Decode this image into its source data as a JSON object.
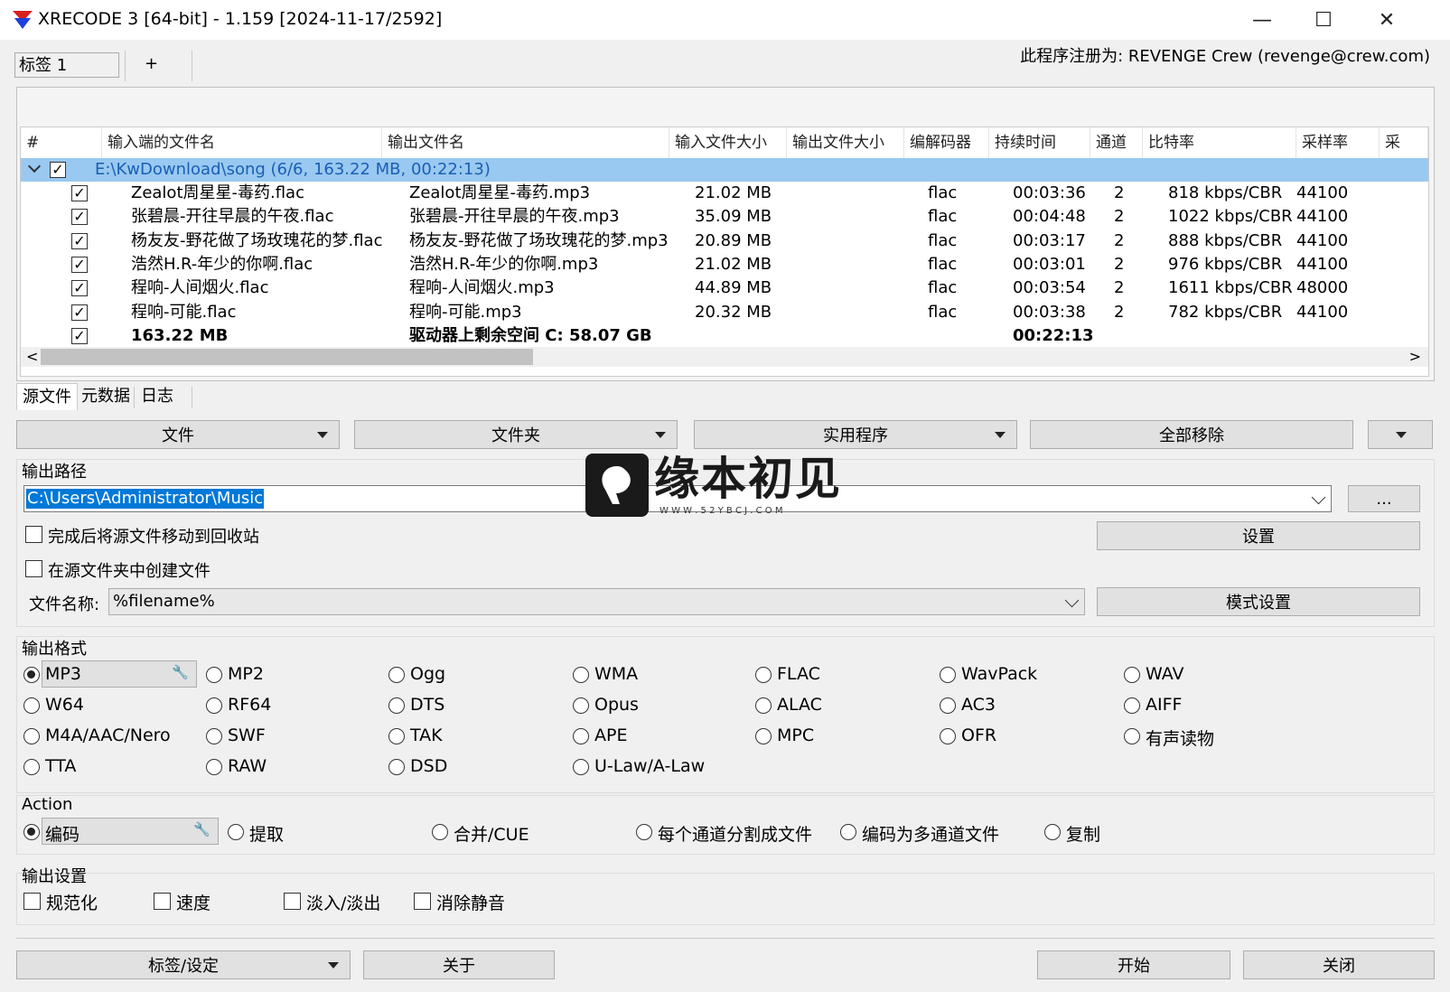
{
  "window": {
    "title": "XRECODE 3 [64-bit] - 1.159 [2024-11-17/2592]",
    "minimize": "—",
    "maximize": "☐",
    "close": "✕"
  },
  "tabs": {
    "tab1": "标签 1",
    "add": "+"
  },
  "registered": "此程序注册为: REVENGE Crew (revenge@crew.com)",
  "table": {
    "headers": [
      "#",
      "输入端的文件名",
      "输出文件名",
      "输入文件大小",
      "输出文件大小",
      "编解码器",
      "持续时间",
      "通道",
      "比特率",
      "采样率",
      "采"
    ],
    "group": "E:\\KwDownload\\song (6/6, 163.22 MB, 00:22:13)",
    "rows": [
      {
        "in": "Zealot周星星-毒药.flac",
        "out": "Zealot周星星-毒药.mp3",
        "size": "21.02 MB",
        "codec": "flac",
        "dur": "00:03:36",
        "ch": "2",
        "br": "818 kbps/CBR",
        "sr": "44100"
      },
      {
        "in": "张碧晨-开往早晨的午夜.flac",
        "out": "张碧晨-开往早晨的午夜.mp3",
        "size": "35.09 MB",
        "codec": "flac",
        "dur": "00:04:48",
        "ch": "2",
        "br": "1022 kbps/CBR",
        "sr": "44100"
      },
      {
        "in": "杨友友-野花做了场玫瑰花的梦.flac",
        "out": "杨友友-野花做了场玫瑰花的梦.mp3",
        "size": "20.89 MB",
        "codec": "flac",
        "dur": "00:03:17",
        "ch": "2",
        "br": "888 kbps/CBR",
        "sr": "44100"
      },
      {
        "in": "浩然H.R-年少的你啊.flac",
        "out": "浩然H.R-年少的你啊.mp3",
        "size": "21.02 MB",
        "codec": "flac",
        "dur": "00:03:01",
        "ch": "2",
        "br": "976 kbps/CBR",
        "sr": "44100"
      },
      {
        "in": "程响-人间烟火.flac",
        "out": "程响-人间烟火.mp3",
        "size": "44.89 MB",
        "codec": "flac",
        "dur": "00:03:54",
        "ch": "2",
        "br": "1611 kbps/CBR",
        "sr": "48000"
      },
      {
        "in": "程响-可能.flac",
        "out": "程响-可能.mp3",
        "size": "20.32 MB",
        "codec": "flac",
        "dur": "00:03:38",
        "ch": "2",
        "br": "782 kbps/CBR",
        "sr": "44100"
      }
    ],
    "total": {
      "size": "163.22 MB",
      "free": "驱动器上剩余空间 C: 58.07 GB",
      "dur": "00:22:13"
    },
    "scroll_left": "<",
    "scroll_right": ">"
  },
  "bottom_tabs": [
    "源文件",
    "元数据",
    "日志"
  ],
  "toolbar": [
    "文件",
    "文件夹",
    "实用程序",
    "全部移除"
  ],
  "output": {
    "path_label": "输出路径",
    "path": "C:\\Users\\Administrator\\Music",
    "browse": "...",
    "move_to_recycle": "完成后将源文件移动到回收站",
    "create_in_source": "在源文件夹中创建文件",
    "settings": "设置",
    "filename_label": "文件名称:",
    "filename": "%filename%",
    "pattern_settings": "模式设置"
  },
  "format": {
    "label": "输出格式",
    "selected": "MP3",
    "options": [
      [
        "MP3",
        "MP2",
        "Ogg",
        "WMA",
        "FLAC",
        "WavPack",
        "WAV"
      ],
      [
        "W64",
        "RF64",
        "DTS",
        "Opus",
        "ALAC",
        "AC3",
        "AIFF"
      ],
      [
        "M4A/AAC/Nero",
        "SWF",
        "TAK",
        "APE",
        "MPC",
        "OFR",
        "有声读物"
      ],
      [
        "TTA",
        "RAW",
        "DSD",
        "U-Law/A-Law"
      ]
    ]
  },
  "action": {
    "label": "Action",
    "options": [
      "编码",
      "提取",
      "合并/CUE",
      "每个通道分割成文件",
      "编码为多通道文件",
      "复制"
    ]
  },
  "out_settings": {
    "label": "输出设置",
    "options": [
      "规范化",
      "速度",
      "淡入/淡出",
      "消除静音"
    ]
  },
  "footer": {
    "tags": "标签/设定",
    "about": "关于",
    "start": "开始",
    "close": "关闭"
  },
  "watermark": {
    "text": "缘本初见",
    "url": "W W W . 5 2 Y B C J . C O M"
  },
  "colors": {
    "selection": "#99c9f1",
    "path_highlight": "#0078d7",
    "group_text": "#1a5fb4"
  }
}
